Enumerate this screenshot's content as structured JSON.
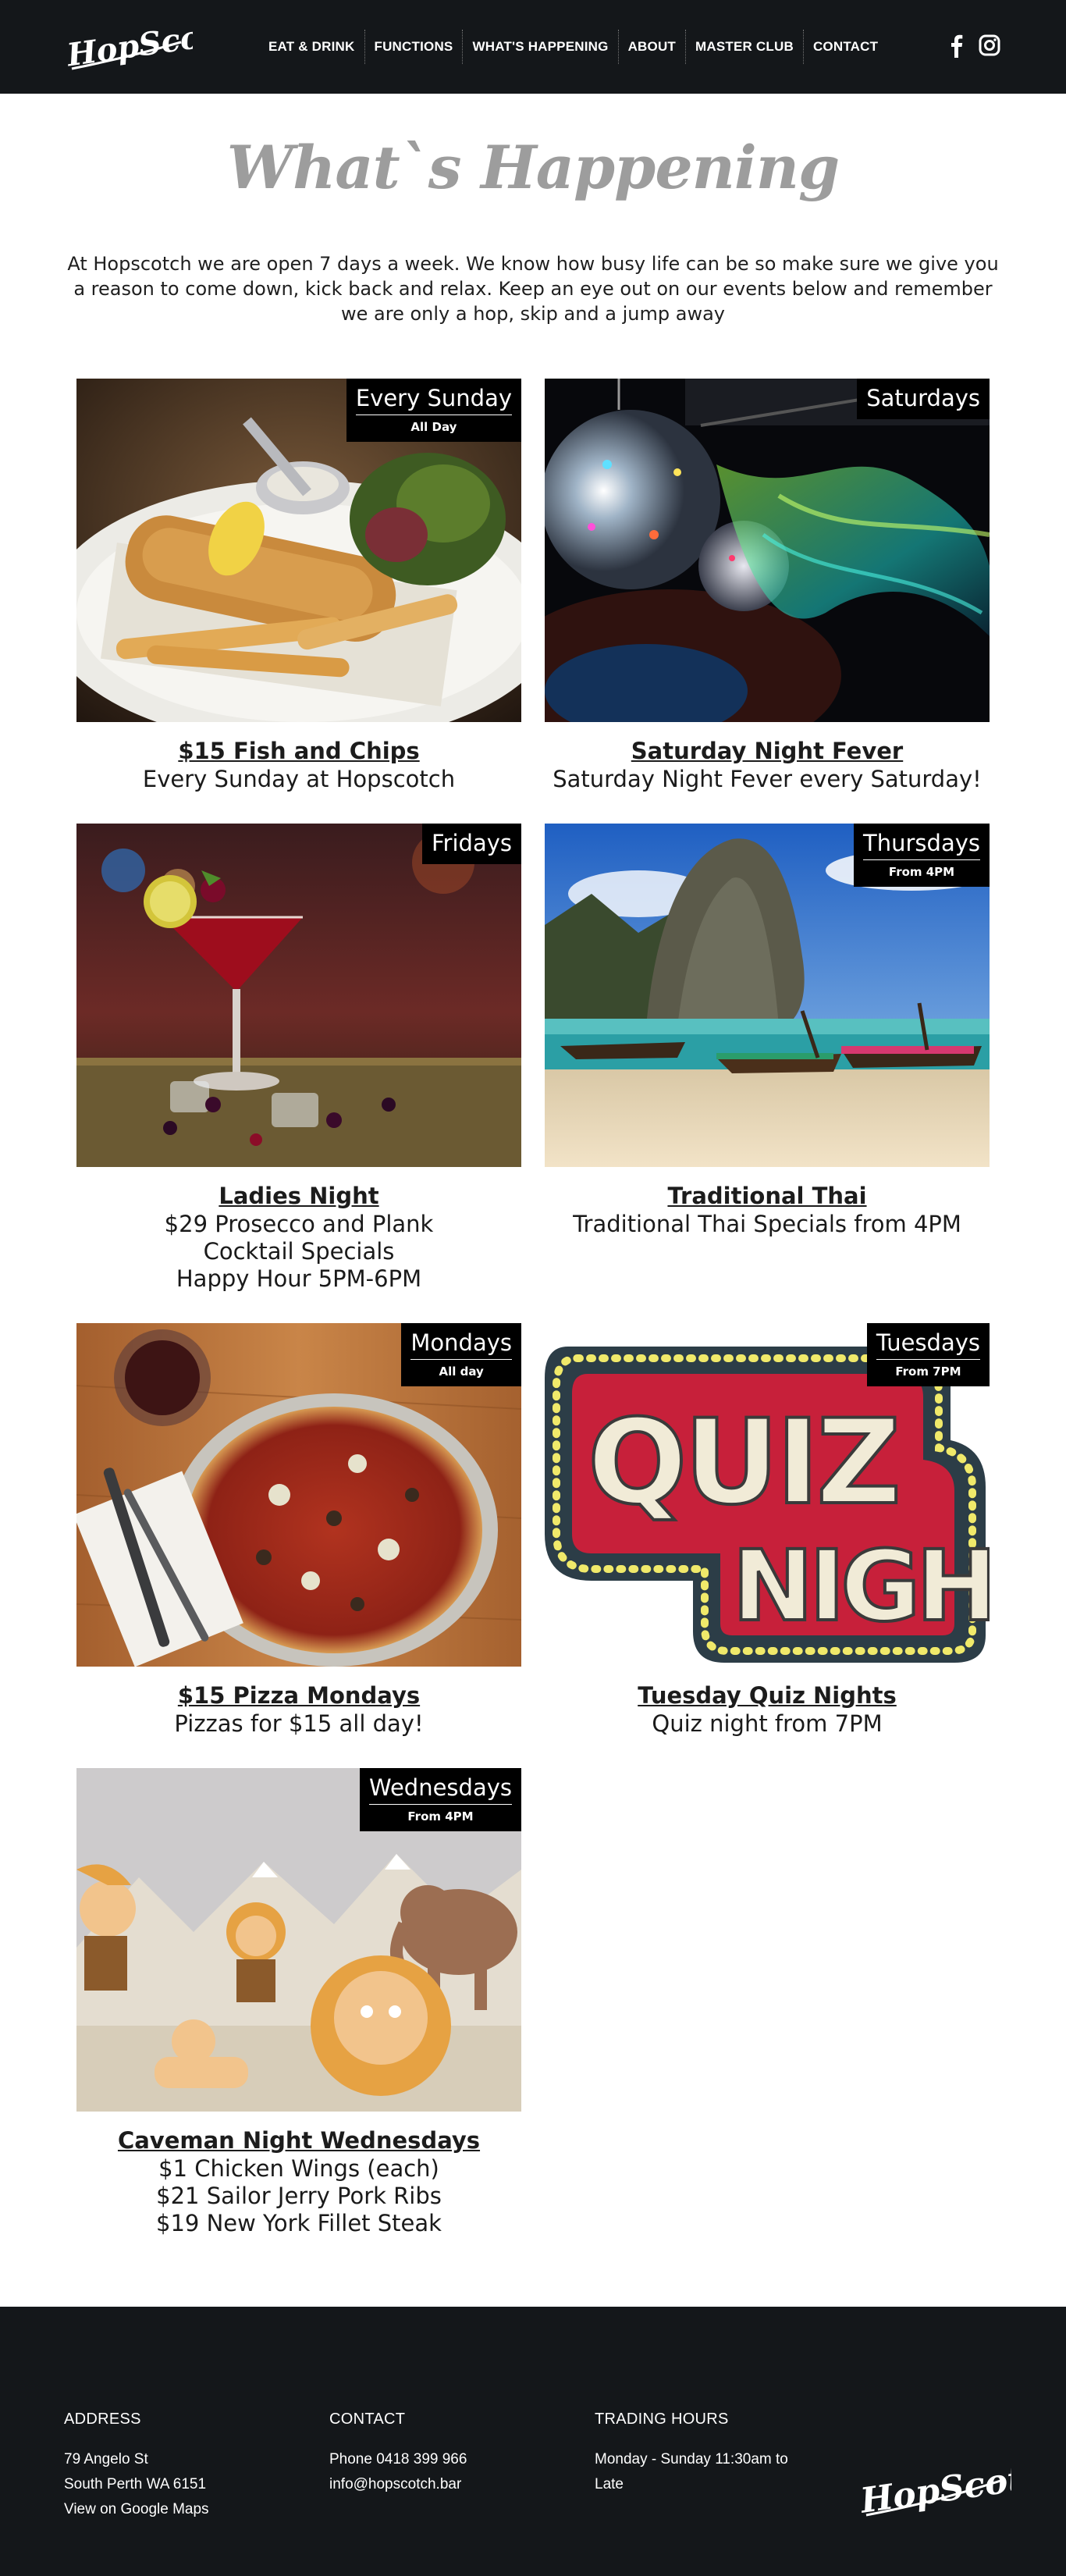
{
  "header": {
    "logo_text": "HopScotch",
    "nav": [
      {
        "label": "EAT & DRINK"
      },
      {
        "label": "FUNCTIONS"
      },
      {
        "label": "WHAT'S HAPPENING"
      },
      {
        "label": "ABOUT"
      },
      {
        "label": "MASTER CLUB"
      },
      {
        "label": "CONTACT"
      }
    ],
    "social": [
      "facebook-icon",
      "instagram-icon"
    ]
  },
  "hero": {
    "title": "What`s Happening",
    "intro": "At Hopscotch we are open 7 days a week. We know how busy life can be so make sure we give you a reason to come down, kick back and relax. Keep an eye out on our events below and remember we are only a hop, skip and a jump away"
  },
  "events": [
    {
      "day": "Every Sunday",
      "sub": "All Day",
      "title": "$15 Fish and Chips",
      "lines": [
        "Every Sunday at Hopscotch"
      ],
      "image": "fish-and-chips"
    },
    {
      "day": "Saturdays",
      "sub": "",
      "title": "Saturday Night Fever",
      "lines": [
        "Saturday Night Fever every Saturday!"
      ],
      "image": "disco-balls"
    },
    {
      "day": "Fridays",
      "sub": "",
      "title": "Ladies Night",
      "lines": [
        "$29 Prosecco and Plank",
        "Cocktail Specials",
        "Happy Hour 5PM-6PM"
      ],
      "image": "cocktail"
    },
    {
      "day": "Thursdays",
      "sub": "From 4PM",
      "title": "Traditional Thai",
      "lines": [
        "Traditional Thai Specials from 4PM"
      ],
      "image": "thai-beach"
    },
    {
      "day": "Mondays",
      "sub": "All day",
      "title": "$15 Pizza Mondays",
      "lines": [
        "Pizzas for $15 all day!"
      ],
      "image": "pizza"
    },
    {
      "day": "Tuesdays",
      "sub": "From 7PM",
      "title": "Tuesday Quiz Nights",
      "lines": [
        "Quiz night from 7PM"
      ],
      "image": "quiz-night",
      "image_text": [
        "QUIZ",
        "NIGHT"
      ]
    },
    {
      "day": "Wednesdays",
      "sub": "From 4PM",
      "title": "Caveman Night Wednesdays",
      "lines": [
        "$1 Chicken Wings (each)",
        "$21 Sailor Jerry Pork Ribs",
        "$19 New York Fillet Steak"
      ],
      "image": "cavemen-cartoon"
    }
  ],
  "footer": {
    "address": {
      "heading": "ADDRESS",
      "lines": [
        "79 Angelo St",
        "South Perth WA 6151",
        "View on Google Maps"
      ]
    },
    "contact": {
      "heading": "CONTACT",
      "lines": [
        "Phone 0418 399 966",
        "info@hopscotch.bar"
      ]
    },
    "hours": {
      "heading": "TRADING HOURS",
      "lines": [
        "Monday - Sunday 11:30am to",
        "Late"
      ]
    },
    "logo_text": "HopScotch"
  },
  "colors": {
    "header_bg": "#14171a",
    "footer_bg": "#14171a",
    "title_grey": "#9d9d9d",
    "tag_bg": "#000000"
  }
}
